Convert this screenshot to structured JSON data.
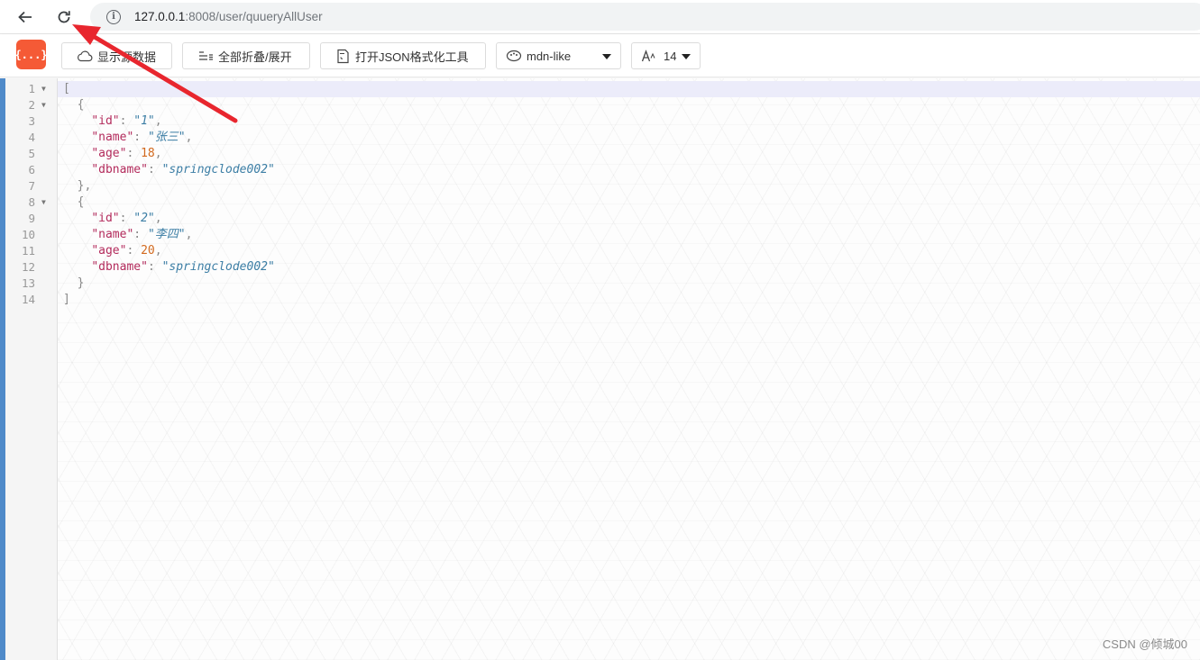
{
  "browser": {
    "url_host": "127.0.0.1",
    "url_path": ":8008/user/quueryAllUser"
  },
  "toolbar": {
    "logo_text": "{...}",
    "raw_label": "显示源数据",
    "fold_label": "全部折叠/展开",
    "open_label": "打开JSON格式化工具",
    "theme_value": "mdn-like",
    "font_size_value": "14"
  },
  "editor": {
    "lines": [
      {
        "num": "1",
        "fold": "▼",
        "segments": [
          {
            "cls": "p",
            "text": "["
          }
        ]
      },
      {
        "num": "2",
        "fold": "▼",
        "segments": [
          {
            "cls": "p",
            "text": "  {"
          }
        ]
      },
      {
        "num": "3",
        "fold": "",
        "segments": [
          {
            "cls": "p",
            "text": "    "
          },
          {
            "cls": "k",
            "text": "\"id\""
          },
          {
            "cls": "p",
            "text": ": "
          },
          {
            "cls": "s",
            "text": "\"1\""
          },
          {
            "cls": "p",
            "text": ","
          }
        ]
      },
      {
        "num": "4",
        "fold": "",
        "segments": [
          {
            "cls": "p",
            "text": "    "
          },
          {
            "cls": "k",
            "text": "\"name\""
          },
          {
            "cls": "p",
            "text": ": "
          },
          {
            "cls": "s",
            "text": "\"张三\""
          },
          {
            "cls": "p",
            "text": ","
          }
        ]
      },
      {
        "num": "5",
        "fold": "",
        "segments": [
          {
            "cls": "p",
            "text": "    "
          },
          {
            "cls": "k",
            "text": "\"age\""
          },
          {
            "cls": "p",
            "text": ": "
          },
          {
            "cls": "n",
            "text": "18"
          },
          {
            "cls": "p",
            "text": ","
          }
        ]
      },
      {
        "num": "6",
        "fold": "",
        "segments": [
          {
            "cls": "p",
            "text": "    "
          },
          {
            "cls": "k",
            "text": "\"dbname\""
          },
          {
            "cls": "p",
            "text": ": "
          },
          {
            "cls": "s",
            "text": "\"springclode002\""
          }
        ]
      },
      {
        "num": "7",
        "fold": "",
        "segments": [
          {
            "cls": "p",
            "text": "  },"
          }
        ]
      },
      {
        "num": "8",
        "fold": "▼",
        "segments": [
          {
            "cls": "p",
            "text": "  {"
          }
        ]
      },
      {
        "num": "9",
        "fold": "",
        "segments": [
          {
            "cls": "p",
            "text": "    "
          },
          {
            "cls": "k",
            "text": "\"id\""
          },
          {
            "cls": "p",
            "text": ": "
          },
          {
            "cls": "s",
            "text": "\"2\""
          },
          {
            "cls": "p",
            "text": ","
          }
        ]
      },
      {
        "num": "10",
        "fold": "",
        "segments": [
          {
            "cls": "p",
            "text": "    "
          },
          {
            "cls": "k",
            "text": "\"name\""
          },
          {
            "cls": "p",
            "text": ": "
          },
          {
            "cls": "s",
            "text": "\"李四\""
          },
          {
            "cls": "p",
            "text": ","
          }
        ]
      },
      {
        "num": "11",
        "fold": "",
        "segments": [
          {
            "cls": "p",
            "text": "    "
          },
          {
            "cls": "k",
            "text": "\"age\""
          },
          {
            "cls": "p",
            "text": ": "
          },
          {
            "cls": "n",
            "text": "20"
          },
          {
            "cls": "p",
            "text": ","
          }
        ]
      },
      {
        "num": "12",
        "fold": "",
        "segments": [
          {
            "cls": "p",
            "text": "    "
          },
          {
            "cls": "k",
            "text": "\"dbname\""
          },
          {
            "cls": "p",
            "text": ": "
          },
          {
            "cls": "s",
            "text": "\"springclode002\""
          }
        ]
      },
      {
        "num": "13",
        "fold": "",
        "segments": [
          {
            "cls": "p",
            "text": "  }"
          }
        ]
      },
      {
        "num": "14",
        "fold": "",
        "segments": [
          {
            "cls": "p",
            "text": "]"
          }
        ]
      }
    ]
  },
  "watermark": "CSDN @倾城00",
  "colors": {
    "annotation_arrow": "#e8262e",
    "logo": "#f55a36",
    "left_strip": "#4f8ac9"
  }
}
